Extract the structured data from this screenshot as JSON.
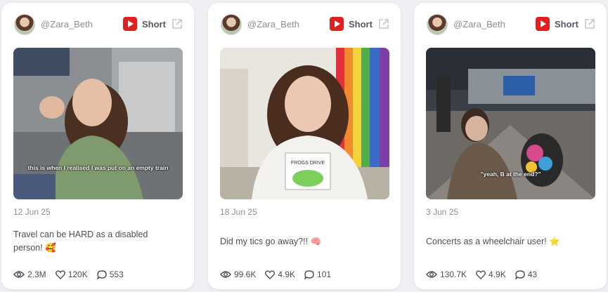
{
  "colors": {
    "accent": "#e01f1f",
    "text_muted": "#8a8f98",
    "text": "#4a4f58",
    "card_bg": "#ffffff",
    "page_bg": "#eef0f4"
  },
  "cards": [
    {
      "handle": "@Zara_Beth",
      "platform_icon": "youtube-icon",
      "type": "Short",
      "overlay_text": "this is when I realised I was put on an empty train",
      "date": "12 Jun 25",
      "title": "Travel can be HARD as a disabled person! 🥰",
      "views": "2.3M",
      "likes": "120K",
      "comments": "553"
    },
    {
      "handle": "@Zara_Beth",
      "platform_icon": "youtube-icon",
      "type": "Short",
      "overlay_text": "",
      "shirt_text": "FROGS DRIVE",
      "date": "18 Jun 25",
      "title": "Did my tics go away?!! 🧠",
      "views": "99.6K",
      "likes": "4.9K",
      "comments": "101"
    },
    {
      "handle": "@Zara_Beth",
      "platform_icon": "youtube-icon",
      "type": "Short",
      "overlay_text": "\"yeah, B at the end?\"",
      "date": "3 Jun 25",
      "title": "Concerts as a wheelchair user! ⭐",
      "views": "130.7K",
      "likes": "4.9K",
      "comments": "43"
    }
  ]
}
